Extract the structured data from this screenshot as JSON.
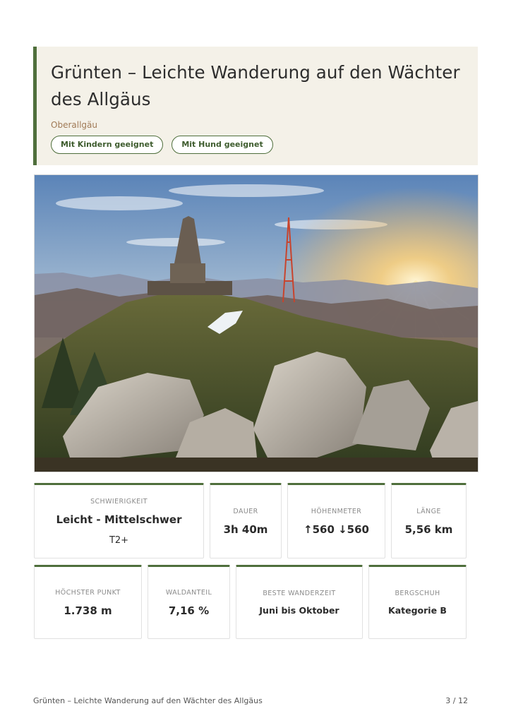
{
  "header": {
    "title": "Grünten – Leichte Wanderung auf den Wächter des Allgäus",
    "region": "Oberallgäu",
    "tags": [
      "Mit Kindern geeignet",
      "Mit Hund geeignet"
    ]
  },
  "stats": {
    "difficulty": {
      "label": "SCHWIERIGKEIT",
      "value": "Leicht - Mittelschwer",
      "sub": "T2+"
    },
    "duration": {
      "label": "DAUER",
      "value": "3h 40m"
    },
    "elevation": {
      "label": "HÖHENMETER",
      "value": "↑560 ↓560"
    },
    "length": {
      "label": "LÄNGE",
      "value": "5,56 km"
    },
    "highest_point": {
      "label": "HÖCHSTER PUNKT",
      "value": "1.738 m"
    },
    "forest_share": {
      "label": "WALDANTEIL",
      "value": "7,16 %"
    },
    "best_time": {
      "label": "BESTE WANDERZEIT",
      "value": "Juni bis Oktober"
    },
    "boot": {
      "label": "BERGSCHUH",
      "value": "Kategorie B"
    }
  },
  "footer": {
    "title": "Grünten – Leichte Wanderung auf den Wächter des Allgäus",
    "page": "3 / 12"
  },
  "colors": {
    "accent": "#4f6f3c",
    "header_bg": "#f4f1e8",
    "region": "#a07a56"
  }
}
